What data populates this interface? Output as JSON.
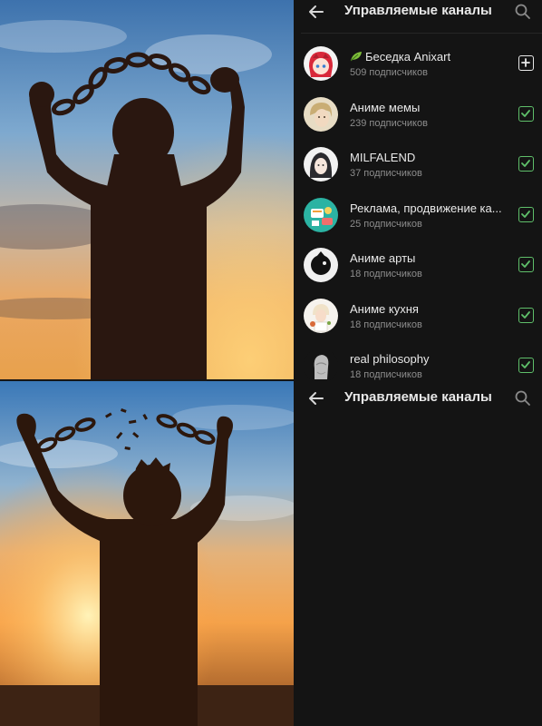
{
  "top_screen": {
    "title": "Управляемые каналы",
    "channels": [
      {
        "name": "Беседка Anixart",
        "subscribers": "509 подписчиков",
        "checkbox": "add",
        "has_leaf": true
      },
      {
        "name": "Аниме мемы",
        "subscribers": "239 подписчиков",
        "checkbox": "checked"
      },
      {
        "name": "MILFALEND",
        "subscribers": "37 подписчиков",
        "checkbox": "checked"
      },
      {
        "name": "Реклама, продвижение ка...",
        "subscribers": "25 подписчиков",
        "checkbox": "checked"
      },
      {
        "name": "Аниме арты",
        "subscribers": "18 подписчиков",
        "checkbox": "checked"
      },
      {
        "name": "Аниме кухня",
        "subscribers": "18 подписчиков",
        "checkbox": "checked"
      },
      {
        "name": "real philosophy",
        "subscribers": "18 подписчиков",
        "checkbox": "checked"
      }
    ]
  },
  "bottom_screen": {
    "title": "Управляемые каналы",
    "channels": []
  },
  "icons": {
    "back": "arrow-left-icon",
    "search": "search-icon",
    "add": "plus-square-icon",
    "checked": "check-square-icon"
  },
  "colors": {
    "panel_background": "#141414",
    "checkbox_checked": "#5fbf6a",
    "subscriber_text": "#8d8d8d"
  }
}
